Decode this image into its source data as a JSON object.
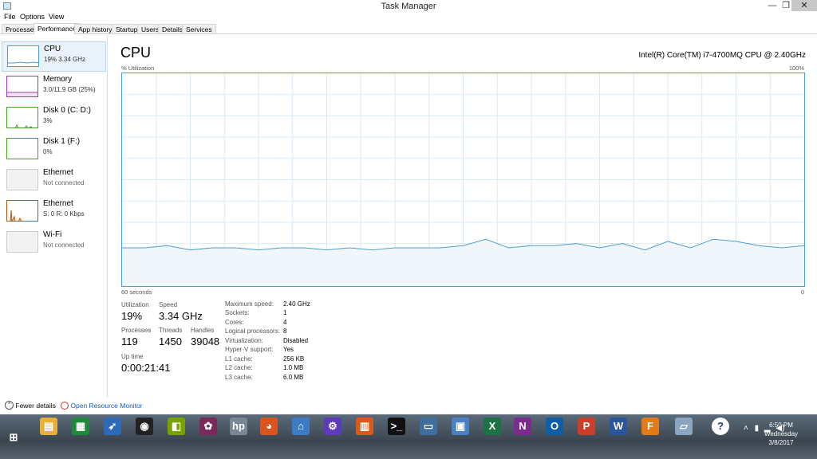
{
  "window": {
    "title": "Task Manager",
    "min": "—",
    "max": "❐",
    "close": "✕"
  },
  "menu": [
    "File",
    "Options",
    "View"
  ],
  "tabs": [
    "Processes",
    "Performance",
    "App history",
    "Startup",
    "Users",
    "Details",
    "Services"
  ],
  "active_tab": "Performance",
  "sidebar": [
    {
      "name": "CPU",
      "sub": "19%  3.34 GHz",
      "color": "#4a9fd0",
      "active": true
    },
    {
      "name": "Memory",
      "sub": "3.0/11.9 GB (25%)",
      "color": "#9b3cb4",
      "active": false
    },
    {
      "name": "Disk 0 (C: D:)",
      "sub": "3%",
      "color": "#4aa02c",
      "active": false
    },
    {
      "name": "Disk 1 (F:)",
      "sub": "0%",
      "color": "#4aa02c",
      "active": false
    },
    {
      "name": "Ethernet",
      "sub": "Not connected",
      "color": "#aaaaaa",
      "active": false
    },
    {
      "name": "Ethernet",
      "sub": "S: 0  R: 0 Kbps",
      "color": "#a7581a",
      "active": false
    },
    {
      "name": "Wi-Fi",
      "sub": "Not connected",
      "color": "#aaaaaa",
      "active": false
    }
  ],
  "main": {
    "title": "CPU",
    "cpu_model": "Intel(R) Core(TM) i7-4700MQ CPU @ 2.40GHz",
    "util_label": "% Utilization",
    "util_max": "100%",
    "time_label": "60 seconds",
    "time_zero": "0",
    "graph_color": "#4a9fd0"
  },
  "chart_data": {
    "type": "area",
    "ylim": [
      0,
      100
    ],
    "x": [
      60,
      58,
      56,
      54,
      52,
      50,
      48,
      46,
      44,
      42,
      40,
      38,
      36,
      34,
      32,
      30,
      28,
      26,
      24,
      22,
      20,
      18,
      16,
      14,
      12,
      10,
      8,
      6,
      4,
      2,
      0
    ],
    "values": [
      18,
      18,
      19,
      17,
      18,
      18,
      17,
      18,
      18,
      17,
      18,
      17,
      18,
      18,
      18,
      19,
      22,
      18,
      19,
      19,
      20,
      18,
      20,
      17,
      21,
      18,
      22,
      21,
      19,
      18,
      19
    ],
    "grid": true
  },
  "stats": {
    "utilization_label": "Utilization",
    "utilization": "19%",
    "speed_label": "Speed",
    "speed": "3.34 GHz",
    "processes_label": "Processes",
    "processes": "119",
    "threads_label": "Threads",
    "threads": "1450",
    "handles_label": "Handles",
    "handles": "39048",
    "uptime_label": "Up time",
    "uptime": "0:00:21:41"
  },
  "specs": [
    {
      "label": "Maximum speed:",
      "value": "2.40 GHz"
    },
    {
      "label": "Sockets:",
      "value": "1"
    },
    {
      "label": "Cores:",
      "value": "4"
    },
    {
      "label": "Logical processors:",
      "value": "8"
    },
    {
      "label": "Virtualization:",
      "value": "Disabled"
    },
    {
      "label": "Hyper-V support:",
      "value": "Yes"
    },
    {
      "label": "L1 cache:",
      "value": "256 KB"
    },
    {
      "label": "L2 cache:",
      "value": "1.0 MB"
    },
    {
      "label": "L3 cache:",
      "value": "6.0 MB"
    }
  ],
  "footer": {
    "fewer": "Fewer details",
    "monitor": "Open Resource Monitor"
  },
  "taskbar": {
    "icons": [
      {
        "name": "start-icon",
        "color": "#ffffff",
        "glyph": "⊞"
      },
      {
        "name": "file-explorer-icon",
        "color": "#e8b03a",
        "glyph": "▤"
      },
      {
        "name": "store-icon",
        "color": "#1f8a3b",
        "glyph": "▦"
      },
      {
        "name": "rocket-icon",
        "color": "#2c6bb8",
        "glyph": "➶"
      },
      {
        "name": "media-player-icon",
        "color": "#222222",
        "glyph": "◉"
      },
      {
        "name": "nvidia-icon",
        "color": "#77a300",
        "glyph": "◧"
      },
      {
        "name": "photos-icon",
        "color": "#7a2a5a",
        "glyph": "✿"
      },
      {
        "name": "hp-icon",
        "color": "#7a8896",
        "glyph": "hp"
      },
      {
        "name": "firefox-icon",
        "color": "#d9541e",
        "glyph": "◕"
      },
      {
        "name": "network-icon",
        "color": "#3d7cc4",
        "glyph": "⌂"
      },
      {
        "name": "settings-icon",
        "color": "#5c3ab8",
        "glyph": "⚙"
      },
      {
        "name": "equalizer-icon",
        "color": "#d85a1a",
        "glyph": "▥"
      },
      {
        "name": "command-prompt-icon",
        "color": "#111111",
        "glyph": ">_"
      },
      {
        "name": "remote-desktop-icon",
        "color": "#3f6e9e",
        "glyph": "▭"
      },
      {
        "name": "picture-icon",
        "color": "#4a80c0",
        "glyph": "▣"
      },
      {
        "name": "excel-icon",
        "color": "#1e7145",
        "glyph": "X"
      },
      {
        "name": "onenote-icon",
        "color": "#7b2c8e",
        "glyph": "N"
      },
      {
        "name": "outlook-icon",
        "color": "#0f5ea8",
        "glyph": "O"
      },
      {
        "name": "powerpoint-icon",
        "color": "#c8402a",
        "glyph": "P"
      },
      {
        "name": "word-icon",
        "color": "#2b579a",
        "glyph": "W"
      },
      {
        "name": "f-app-icon",
        "color": "#e07a1a",
        "glyph": "F"
      },
      {
        "name": "task-manager-icon",
        "color": "#8aa6c0",
        "glyph": "▱"
      },
      {
        "name": "help-icon",
        "color": "#1f3b8a",
        "glyph": "?"
      }
    ],
    "time": "6:50 PM",
    "day": "Wednesday",
    "date": "3/8/2017"
  }
}
